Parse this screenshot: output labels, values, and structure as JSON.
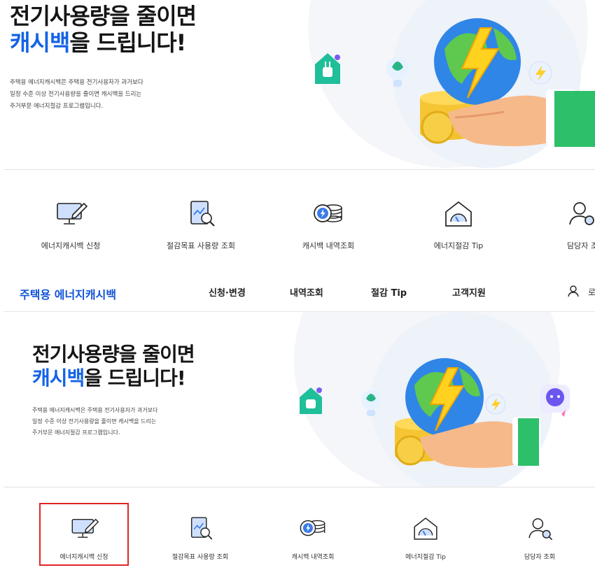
{
  "hero": {
    "title_line1": "전기사용량을 줄이면",
    "title_accent": "캐시백",
    "title_rest": "을 드립니다!",
    "desc_line1": "주택용 에너지캐시백은 주택용 전기사용자가 과거보다",
    "desc_line2": "일정 수준 이상 전기사용량을 줄이면 캐시백을 드리는",
    "desc_line3": "주거부문 에너지절감 프로그램입니다."
  },
  "quick_menu": [
    {
      "label": "에너지캐시백 신청",
      "icon": "monitor-pen-icon"
    },
    {
      "label": "절감목표 사용량 조회",
      "icon": "report-search-icon"
    },
    {
      "label": "캐시백 내역조회",
      "icon": "coin-stack-icon"
    },
    {
      "label": "에너지절감 Tip",
      "icon": "house-gauge-icon"
    },
    {
      "label": "담당자 조회",
      "icon": "person-search-icon"
    }
  ],
  "quick_menu_top_cut_label": "담당자 조",
  "gnb": {
    "logo": "주택용 에너지캐시백",
    "links": [
      "신청·변경",
      "내역조회",
      "절감 Tip",
      "고객지원"
    ],
    "user_icon": "user-icon",
    "cut_text": "로"
  },
  "colors": {
    "accent": "#1463e6",
    "logo": "#1153d6",
    "highlight": "#e02424",
    "icon_blue": "#3b7be8"
  }
}
